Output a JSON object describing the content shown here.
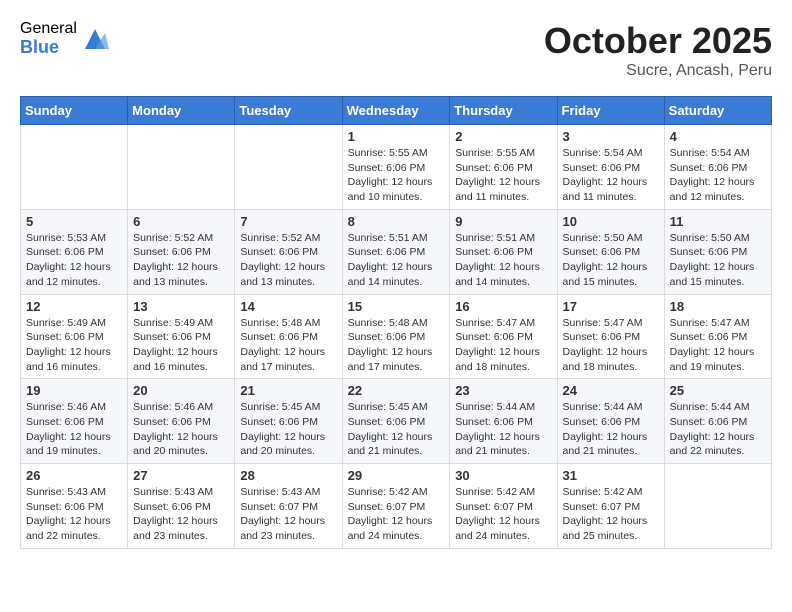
{
  "header": {
    "logo_general": "General",
    "logo_blue": "Blue",
    "month_title": "October 2025",
    "subtitle": "Sucre, Ancash, Peru"
  },
  "days_of_week": [
    "Sunday",
    "Monday",
    "Tuesday",
    "Wednesday",
    "Thursday",
    "Friday",
    "Saturday"
  ],
  "weeks": [
    [
      {
        "day": "",
        "info": ""
      },
      {
        "day": "",
        "info": ""
      },
      {
        "day": "",
        "info": ""
      },
      {
        "day": "1",
        "info": "Sunrise: 5:55 AM\nSunset: 6:06 PM\nDaylight: 12 hours and 10 minutes."
      },
      {
        "day": "2",
        "info": "Sunrise: 5:55 AM\nSunset: 6:06 PM\nDaylight: 12 hours and 11 minutes."
      },
      {
        "day": "3",
        "info": "Sunrise: 5:54 AM\nSunset: 6:06 PM\nDaylight: 12 hours and 11 minutes."
      },
      {
        "day": "4",
        "info": "Sunrise: 5:54 AM\nSunset: 6:06 PM\nDaylight: 12 hours and 12 minutes."
      }
    ],
    [
      {
        "day": "5",
        "info": "Sunrise: 5:53 AM\nSunset: 6:06 PM\nDaylight: 12 hours and 12 minutes."
      },
      {
        "day": "6",
        "info": "Sunrise: 5:52 AM\nSunset: 6:06 PM\nDaylight: 12 hours and 13 minutes."
      },
      {
        "day": "7",
        "info": "Sunrise: 5:52 AM\nSunset: 6:06 PM\nDaylight: 12 hours and 13 minutes."
      },
      {
        "day": "8",
        "info": "Sunrise: 5:51 AM\nSunset: 6:06 PM\nDaylight: 12 hours and 14 minutes."
      },
      {
        "day": "9",
        "info": "Sunrise: 5:51 AM\nSunset: 6:06 PM\nDaylight: 12 hours and 14 minutes."
      },
      {
        "day": "10",
        "info": "Sunrise: 5:50 AM\nSunset: 6:06 PM\nDaylight: 12 hours and 15 minutes."
      },
      {
        "day": "11",
        "info": "Sunrise: 5:50 AM\nSunset: 6:06 PM\nDaylight: 12 hours and 15 minutes."
      }
    ],
    [
      {
        "day": "12",
        "info": "Sunrise: 5:49 AM\nSunset: 6:06 PM\nDaylight: 12 hours and 16 minutes."
      },
      {
        "day": "13",
        "info": "Sunrise: 5:49 AM\nSunset: 6:06 PM\nDaylight: 12 hours and 16 minutes."
      },
      {
        "day": "14",
        "info": "Sunrise: 5:48 AM\nSunset: 6:06 PM\nDaylight: 12 hours and 17 minutes."
      },
      {
        "day": "15",
        "info": "Sunrise: 5:48 AM\nSunset: 6:06 PM\nDaylight: 12 hours and 17 minutes."
      },
      {
        "day": "16",
        "info": "Sunrise: 5:47 AM\nSunset: 6:06 PM\nDaylight: 12 hours and 18 minutes."
      },
      {
        "day": "17",
        "info": "Sunrise: 5:47 AM\nSunset: 6:06 PM\nDaylight: 12 hours and 18 minutes."
      },
      {
        "day": "18",
        "info": "Sunrise: 5:47 AM\nSunset: 6:06 PM\nDaylight: 12 hours and 19 minutes."
      }
    ],
    [
      {
        "day": "19",
        "info": "Sunrise: 5:46 AM\nSunset: 6:06 PM\nDaylight: 12 hours and 19 minutes."
      },
      {
        "day": "20",
        "info": "Sunrise: 5:46 AM\nSunset: 6:06 PM\nDaylight: 12 hours and 20 minutes."
      },
      {
        "day": "21",
        "info": "Sunrise: 5:45 AM\nSunset: 6:06 PM\nDaylight: 12 hours and 20 minutes."
      },
      {
        "day": "22",
        "info": "Sunrise: 5:45 AM\nSunset: 6:06 PM\nDaylight: 12 hours and 21 minutes."
      },
      {
        "day": "23",
        "info": "Sunrise: 5:44 AM\nSunset: 6:06 PM\nDaylight: 12 hours and 21 minutes."
      },
      {
        "day": "24",
        "info": "Sunrise: 5:44 AM\nSunset: 6:06 PM\nDaylight: 12 hours and 21 minutes."
      },
      {
        "day": "25",
        "info": "Sunrise: 5:44 AM\nSunset: 6:06 PM\nDaylight: 12 hours and 22 minutes."
      }
    ],
    [
      {
        "day": "26",
        "info": "Sunrise: 5:43 AM\nSunset: 6:06 PM\nDaylight: 12 hours and 22 minutes."
      },
      {
        "day": "27",
        "info": "Sunrise: 5:43 AM\nSunset: 6:06 PM\nDaylight: 12 hours and 23 minutes."
      },
      {
        "day": "28",
        "info": "Sunrise: 5:43 AM\nSunset: 6:07 PM\nDaylight: 12 hours and 23 minutes."
      },
      {
        "day": "29",
        "info": "Sunrise: 5:42 AM\nSunset: 6:07 PM\nDaylight: 12 hours and 24 minutes."
      },
      {
        "day": "30",
        "info": "Sunrise: 5:42 AM\nSunset: 6:07 PM\nDaylight: 12 hours and 24 minutes."
      },
      {
        "day": "31",
        "info": "Sunrise: 5:42 AM\nSunset: 6:07 PM\nDaylight: 12 hours and 25 minutes."
      },
      {
        "day": "",
        "info": ""
      }
    ]
  ]
}
